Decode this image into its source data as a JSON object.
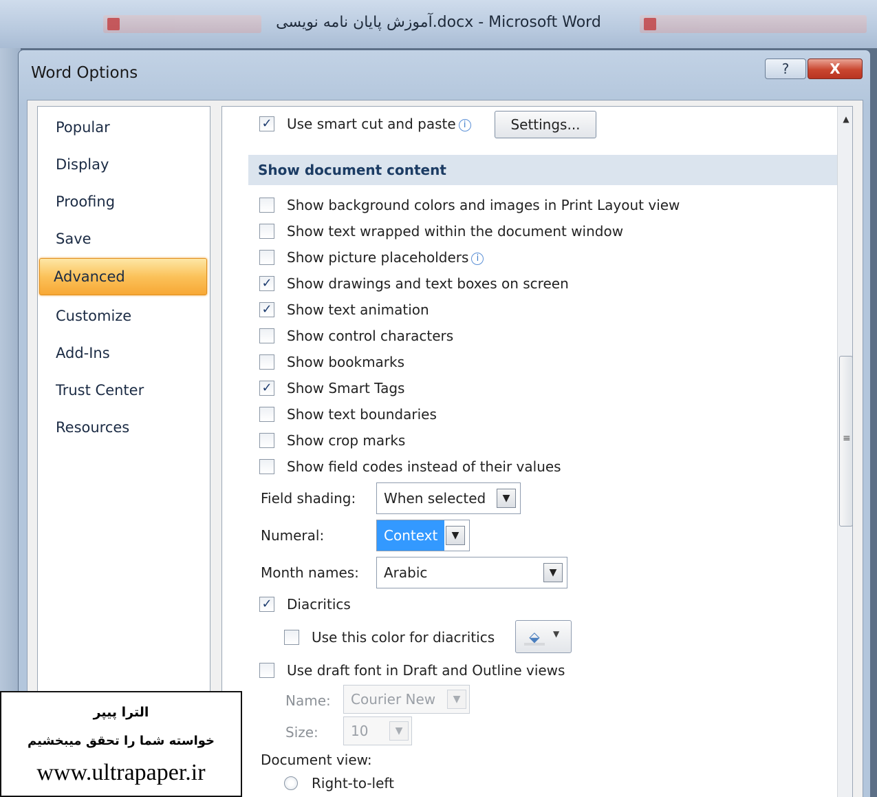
{
  "window": {
    "title": "آموزش پایان نامه نویسی.docx - Microsoft Word"
  },
  "dialog": {
    "title": "Word Options",
    "help_label": "?",
    "close_label": "X"
  },
  "nav": {
    "items": [
      {
        "label": "Popular"
      },
      {
        "label": "Display"
      },
      {
        "label": "Proofing"
      },
      {
        "label": "Save"
      },
      {
        "label": "Advanced",
        "selected": true
      },
      {
        "label": "Customize"
      },
      {
        "label": "Add-Ins"
      },
      {
        "label": "Trust Center"
      },
      {
        "label": "Resources"
      }
    ]
  },
  "content": {
    "smart_cut": {
      "label": "Use smart cut and paste",
      "checked": true,
      "settings_label": "Settings..."
    },
    "section_title": "Show document content",
    "options": [
      {
        "label": "Show background colors and images in Print Layout view",
        "checked": false
      },
      {
        "label": "Show text wrapped within the document window",
        "checked": false
      },
      {
        "label": "Show picture placeholders",
        "checked": false
      },
      {
        "label": "Show drawings and text boxes on screen",
        "checked": true
      },
      {
        "label": "Show text animation",
        "checked": true
      },
      {
        "label": "Show control characters",
        "checked": false
      },
      {
        "label": "Show bookmarks",
        "checked": false
      },
      {
        "label": "Show Smart Tags",
        "checked": true
      },
      {
        "label": "Show text boundaries",
        "checked": false
      },
      {
        "label": "Show crop marks",
        "checked": false
      },
      {
        "label": "Show field codes instead of their values",
        "checked": false
      }
    ],
    "field_shading": {
      "label": "Field shading:",
      "value": "When selected"
    },
    "numeral": {
      "label": "Numeral:",
      "value": "Context"
    },
    "month_names": {
      "label": "Month names:",
      "value": "Arabic"
    },
    "diacritics": {
      "label": "Diacritics",
      "checked": true
    },
    "diacritics_color": {
      "label": "Use this color for diacritics",
      "checked": false
    },
    "draft_font": {
      "label": "Use draft font in Draft and Outline views",
      "checked": false
    },
    "font_name": {
      "label": "Name:",
      "value": "Courier New"
    },
    "font_size": {
      "label": "Size:",
      "value": "10"
    },
    "document_view": {
      "label": "Document view:"
    },
    "rtl": {
      "label": "Right-to-left"
    }
  },
  "watermark": {
    "line1": "الترا پیپر",
    "line2": "خواسته شما را تحقق میبخشیم",
    "line3": "www.ultrapaper.ir"
  },
  "icons": {
    "check": "✓",
    "info": "i",
    "dropdown": "▼",
    "scroll_up": "▲",
    "grip": "≡",
    "paint": "paint-bucket-icon"
  }
}
